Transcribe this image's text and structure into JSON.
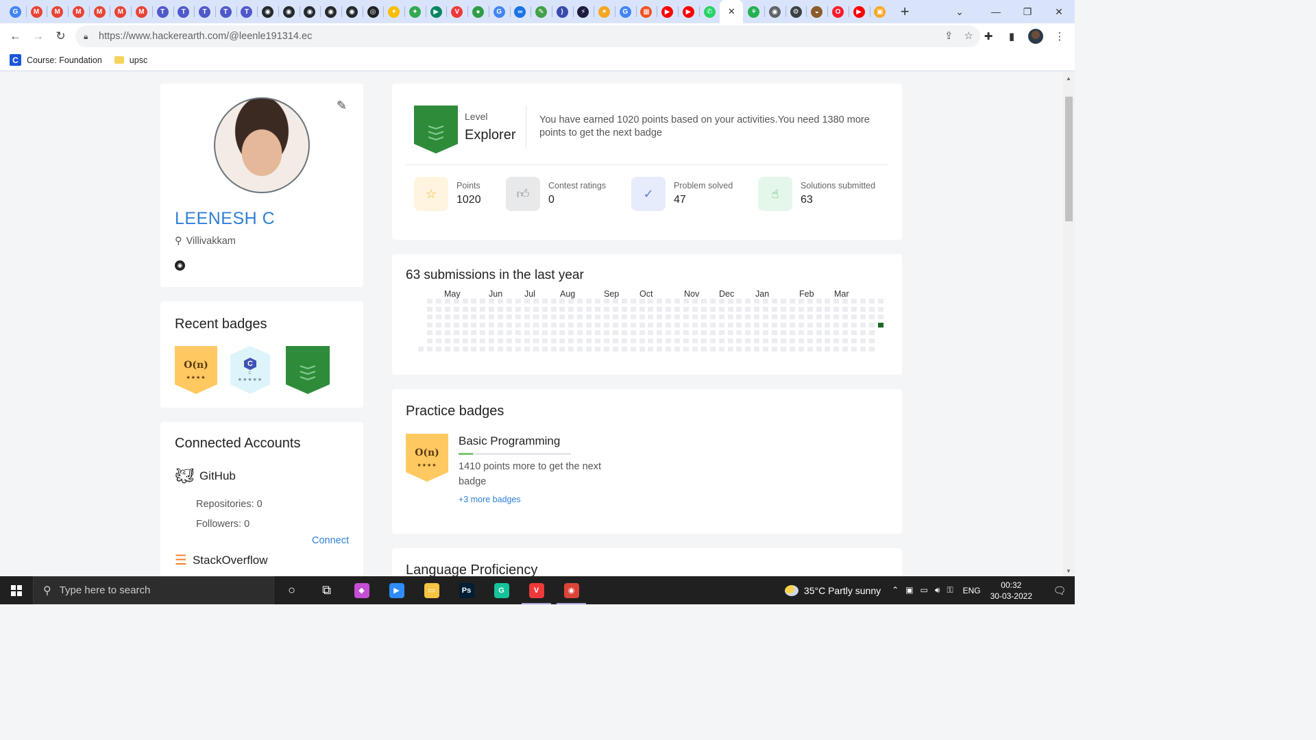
{
  "browser": {
    "tabs": [
      {
        "icon": "google-icon",
        "color": "#4285f4",
        "glyph": "G"
      },
      {
        "icon": "gmail-icon",
        "color": "#ea4335",
        "glyph": "M"
      },
      {
        "icon": "gmail-icon",
        "color": "#ea4335",
        "glyph": "M"
      },
      {
        "icon": "gmail-icon",
        "color": "#ea4335",
        "glyph": "M"
      },
      {
        "icon": "gmail-icon",
        "color": "#ea4335",
        "glyph": "M"
      },
      {
        "icon": "gmail-icon",
        "color": "#ea4335",
        "glyph": "M"
      },
      {
        "icon": "gmail-icon",
        "color": "#ea4335",
        "glyph": "M"
      },
      {
        "icon": "teams-icon",
        "color": "#5059c9",
        "glyph": "T"
      },
      {
        "icon": "teams-icon",
        "color": "#5059c9",
        "glyph": "T"
      },
      {
        "icon": "teams-icon",
        "color": "#5059c9",
        "glyph": "T"
      },
      {
        "icon": "teams-icon",
        "color": "#5059c9",
        "glyph": "T"
      },
      {
        "icon": "teams-icon",
        "color": "#5059c9",
        "glyph": "T"
      },
      {
        "icon": "github-icon",
        "color": "#24292e",
        "glyph": "◉"
      },
      {
        "icon": "github-icon",
        "color": "#24292e",
        "glyph": "◉"
      },
      {
        "icon": "github-icon",
        "color": "#24292e",
        "glyph": "◉"
      },
      {
        "icon": "github-icon",
        "color": "#24292e",
        "glyph": "◉"
      },
      {
        "icon": "github-icon",
        "color": "#24292e",
        "glyph": "◉"
      },
      {
        "icon": "globe-icon",
        "color": "#202124",
        "glyph": "◎"
      },
      {
        "icon": "pinwheel-icon",
        "color": "#fbbc05",
        "glyph": "✦"
      },
      {
        "icon": "pinwheel-icon",
        "color": "#34a853",
        "glyph": "✦"
      },
      {
        "icon": "play-icon",
        "color": "#01875f",
        "glyph": "▶"
      },
      {
        "icon": "vivaldi-icon",
        "color": "#ef3939",
        "glyph": "V"
      },
      {
        "icon": "green-app-icon",
        "color": "#2e9e45",
        "glyph": "●"
      },
      {
        "icon": "google-icon",
        "color": "#4285f4",
        "glyph": "G"
      },
      {
        "icon": "link-icon",
        "color": "#1a73e8",
        "glyph": "∞"
      },
      {
        "icon": "leaf-icon",
        "color": "#43a047",
        "glyph": "✎"
      },
      {
        "icon": "dart-icon",
        "color": "#3949ab",
        "glyph": "⟩"
      },
      {
        "icon": "bolt-icon",
        "color": "#1c1c3c",
        "glyph": "⚡"
      },
      {
        "icon": "orange-app-icon",
        "color": "#f5a623",
        "glyph": "✶"
      },
      {
        "icon": "google-icon",
        "color": "#4285f4",
        "glyph": "G"
      },
      {
        "icon": "microsoft-icon",
        "color": "#f25022",
        "glyph": "▦"
      },
      {
        "icon": "youtube-icon",
        "color": "#ff0000",
        "glyph": "▶"
      },
      {
        "icon": "youtube-icon",
        "color": "#ff0000",
        "glyph": "▶"
      },
      {
        "icon": "whatsapp-icon",
        "color": "#25d366",
        "glyph": "✆"
      },
      {
        "icon": "close-icon",
        "color": "#ffffff",
        "glyph": "✕",
        "active": true
      },
      {
        "icon": "green-app-icon",
        "color": "#26b050",
        "glyph": "⚘"
      },
      {
        "icon": "chrome-icon",
        "color": "#5f6368",
        "glyph": "◉"
      },
      {
        "icon": "gear-icon",
        "color": "#3c4043",
        "glyph": "⚙"
      },
      {
        "icon": "burger-icon",
        "color": "#8d5b2a",
        "glyph": "◒"
      },
      {
        "icon": "opera-icon",
        "color": "#ff1b2d",
        "glyph": "O"
      },
      {
        "icon": "youtube-icon",
        "color": "#ff0000",
        "glyph": "▶"
      },
      {
        "icon": "photos-icon",
        "color": "#f9a825",
        "glyph": "▣"
      }
    ],
    "url": "https://www.hackerearth.com/@leenle191314.ec",
    "bookmarks": [
      {
        "label": "Course: Foundation"
      },
      {
        "label": "upsc"
      }
    ]
  },
  "profile": {
    "name": "LEENESH C",
    "location": "Villivakkam"
  },
  "recent_badges": {
    "title": "Recent badges",
    "items": [
      {
        "kind": "orange",
        "main": "O(n)",
        "stars": "★★★★"
      },
      {
        "kind": "cyan",
        "main": "C",
        "sub": "C",
        "stars": "★★★★★"
      },
      {
        "kind": "green"
      }
    ]
  },
  "connected_accounts": {
    "title": "Connected Accounts",
    "github": {
      "name": "GitHub",
      "repositories": "Repositories: 0",
      "followers": "Followers: 0",
      "connect": "Connect"
    },
    "stackoverflow": {
      "name": "StackOverflow"
    }
  },
  "level": {
    "label": "Level",
    "value": "Explorer",
    "message": "You have earned 1020 points based on your activities.You need 1380 more points to get the next badge"
  },
  "stats": [
    {
      "label": "Points",
      "value": "1020",
      "icon": "star-icon",
      "bg": "#fff4df",
      "color": "#f5b731",
      "glyph": "☆"
    },
    {
      "label": "Contest ratings",
      "value": "0",
      "icon": "thumbs-up-icon",
      "bg": "#e8e9eb",
      "color": "#8a8f96",
      "glyph": "👍︎"
    },
    {
      "label": "Problem solved",
      "value": "47",
      "icon": "check-circle-icon",
      "bg": "#e6ecfb",
      "color": "#5b7be0",
      "glyph": "✓"
    },
    {
      "label": "Solutions submitted",
      "value": "63",
      "icon": "hand-pointer-icon",
      "bg": "#e5f6ea",
      "color": "#3fb46a",
      "glyph": "☝"
    }
  ],
  "activity": {
    "title": "63 submissions in the last year",
    "months": [
      "May",
      "Jun",
      "Jul",
      "Aug",
      "Sep",
      "Oct",
      "Nov",
      "Dec",
      "Jan",
      "Feb",
      "Mar"
    ]
  },
  "practice_badges": {
    "title": "Practice badges",
    "badge_main": "O(n)",
    "badge_stars": "★★★★",
    "name": "Basic Programming",
    "progress": 0.13,
    "message": "1410 points more to get the next badge",
    "more": "+3 more badges"
  },
  "language": {
    "title": "Language Proficiency"
  },
  "taskbar": {
    "search_placeholder": "Type here to search",
    "apps": [
      {
        "icon": "cortana-icon",
        "color": "#202020",
        "glyph": "○"
      },
      {
        "icon": "task-view-icon",
        "color": "#202020",
        "glyph": "⧉"
      },
      {
        "icon": "git-icon",
        "color": "#c44fd4",
        "glyph": "◆"
      },
      {
        "icon": "zoom-icon",
        "color": "#2d8cff",
        "glyph": "▶"
      },
      {
        "icon": "file-explorer-icon",
        "color": "#f6c342",
        "glyph": "▭"
      },
      {
        "icon": "photoshop-icon",
        "color": "#001e36",
        "glyph": "Ps"
      },
      {
        "icon": "grammarly-icon",
        "color": "#15c39a",
        "glyph": "G"
      },
      {
        "icon": "vivaldi-icon",
        "color": "#ef3939",
        "glyph": "V",
        "open": true
      },
      {
        "icon": "chrome-icon",
        "color": "#db4437",
        "glyph": "◉",
        "open": true
      }
    ],
    "weather": "35°C  Partly sunny",
    "language": "ENG",
    "time": "00:32",
    "date": "30-03-2022"
  }
}
